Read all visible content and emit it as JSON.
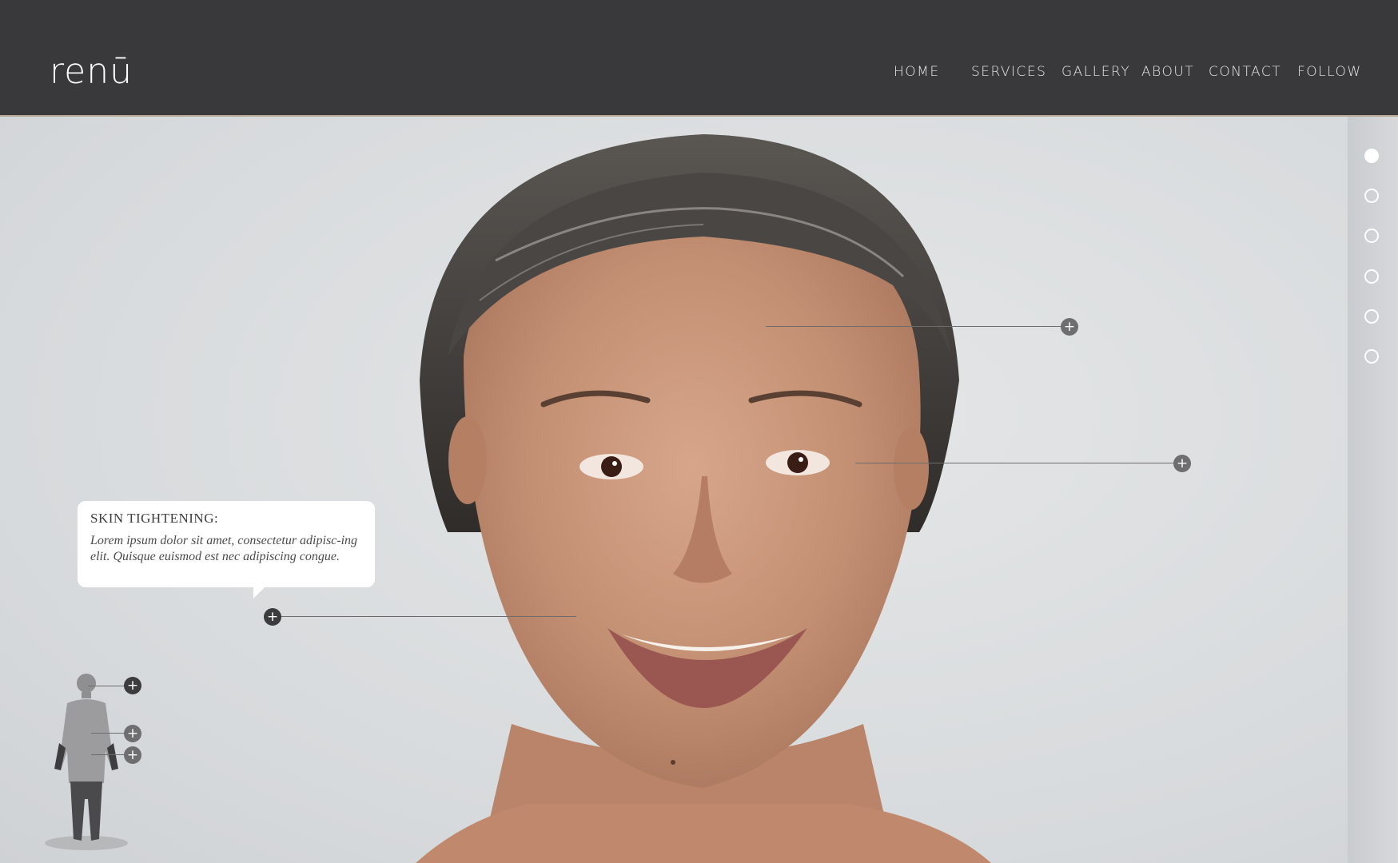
{
  "header": {
    "logo": "renū",
    "nav": [
      {
        "label": "HOME"
      },
      {
        "label": "SERVICES"
      },
      {
        "label": "GALLERY"
      },
      {
        "label": "ABOUT"
      },
      {
        "label": "CONTACT"
      },
      {
        "label": "FOLLOW"
      }
    ]
  },
  "callout": {
    "title": "SKIN TIGHTENING:",
    "body": "Lorem ipsum dolor sit amet, consectetur adipisc-ing elit. Quisque euismod est nec adipiscing congue."
  },
  "hotspots": [
    {
      "name": "forehead",
      "icon": "plus-icon"
    },
    {
      "name": "eyes",
      "icon": "plus-icon"
    },
    {
      "name": "cheek",
      "icon": "plus-icon"
    }
  ],
  "body_map": {
    "hotspots": [
      {
        "name": "head",
        "icon": "plus-icon"
      },
      {
        "name": "torso",
        "icon": "plus-icon"
      },
      {
        "name": "waist",
        "icon": "plus-icon"
      }
    ]
  },
  "slides": {
    "count": 6,
    "active": 1
  },
  "colors": {
    "header": "#39393b",
    "accent_border": "#b8a996",
    "rail": "#cfd2d4"
  }
}
